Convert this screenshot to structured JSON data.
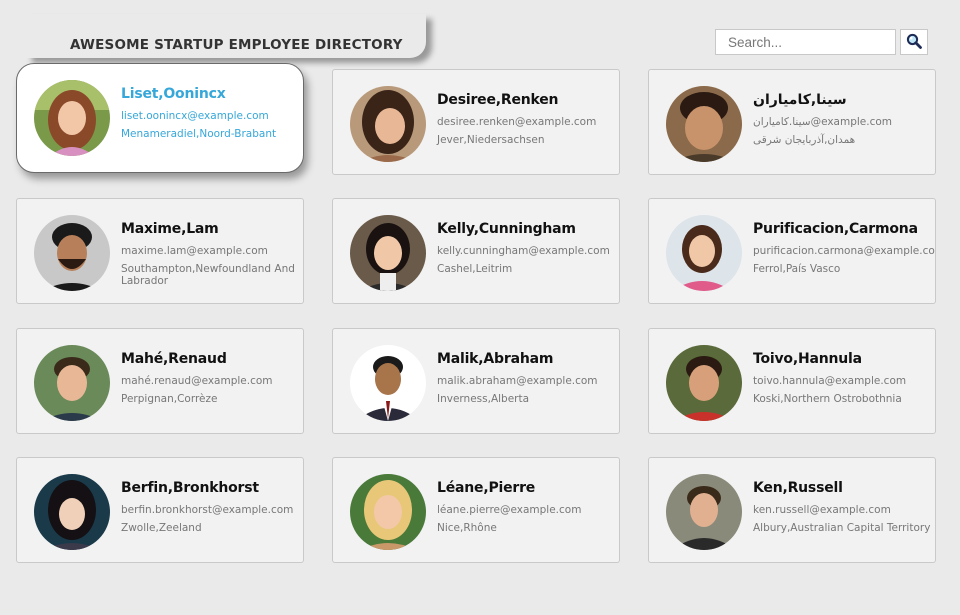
{
  "header": {
    "title": "AWESOME STARTUP EMPLOYEE DIRECTORY"
  },
  "search": {
    "placeholder": "Search...",
    "button_icon": "magnifier-icon"
  },
  "colors": {
    "background": "#eaeaea",
    "card_bg": "#f2f2f2",
    "active_card_bg": "#ffffff",
    "active_text": "#36a7d9",
    "name_text": "#111111",
    "detail_text": "#777777"
  },
  "employees": [
    {
      "name": "Liset,Oonincx",
      "email": "liset.oonincx@example.com",
      "location": "Menameradiel,Noord-Brabant",
      "active": true
    },
    {
      "name": "Desiree,Renken",
      "email": "desiree.renken@example.com",
      "location": "Jever,Niedersachsen"
    },
    {
      "name": "سینا,کامیاران",
      "email": "سینا.کامیاران@example.com",
      "location": "همدان,آذربایجان شرقی"
    },
    {
      "name": "Maxime,Lam",
      "email": "maxime.lam@example.com",
      "location": "Southampton,Newfoundland And Labrador"
    },
    {
      "name": "Kelly,Cunningham",
      "email": "kelly.cunningham@example.com",
      "location": "Cashel,Leitrim"
    },
    {
      "name": "Purificacion,Carmona",
      "email": "purificacion.carmona@example.com",
      "location": "Ferrol,País Vasco"
    },
    {
      "name": "Mahé,Renaud",
      "email": "mahé.renaud@example.com",
      "location": "Perpignan,Corrèze"
    },
    {
      "name": "Malik,Abraham",
      "email": "malik.abraham@example.com",
      "location": "Inverness,Alberta"
    },
    {
      "name": "Toivo,Hannula",
      "email": "toivo.hannula@example.com",
      "location": "Koski,Northern Ostrobothnia"
    },
    {
      "name": "Berfin,Bronkhorst",
      "email": "berfin.bronkhorst@example.com",
      "location": "Zwolle,Zeeland"
    },
    {
      "name": "Léane,Pierre",
      "email": "léane.pierre@example.com",
      "location": "Nice,Rhône"
    },
    {
      "name": "Ken,Russell",
      "email": "ken.russell@example.com",
      "location": "Albury,Australian Capital Territory"
    }
  ]
}
